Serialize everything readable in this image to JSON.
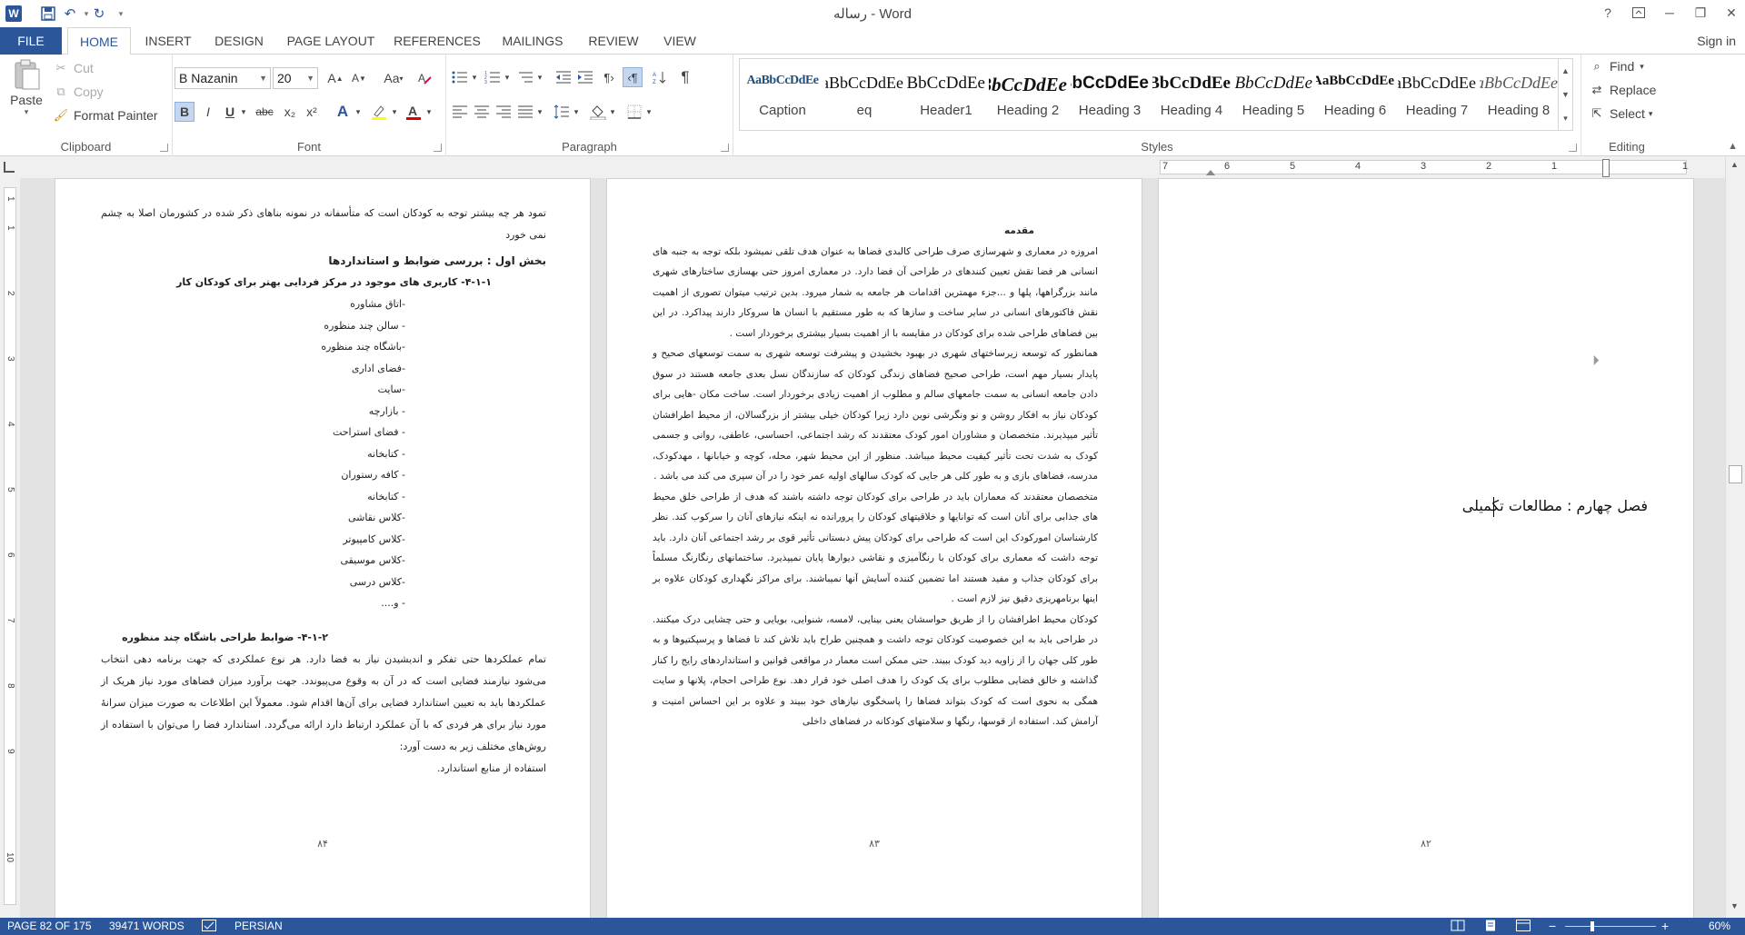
{
  "app": {
    "title": "رساله - Word",
    "qat": [
      "save-icon",
      "undo-icon",
      "redo-icon",
      "customize-icon"
    ],
    "window_buttons": [
      "?",
      "restore-ribbon",
      "─",
      "❐",
      "✕"
    ]
  },
  "tabs": {
    "file": "FILE",
    "items": [
      "HOME",
      "INSERT",
      "DESIGN",
      "PAGE LAYOUT",
      "REFERENCES",
      "MAILINGS",
      "REVIEW",
      "VIEW"
    ],
    "active": "HOME",
    "signin": "Sign in"
  },
  "clipboard": {
    "paste": "Paste",
    "cut": "Cut",
    "copy": "Copy",
    "format_painter": "Format Painter",
    "label": "Clipboard"
  },
  "font": {
    "name": "B Nazanin",
    "size": "20",
    "grow": "A",
    "shrink": "A",
    "case": "Aa",
    "bold": "B",
    "italic": "I",
    "underline": "U",
    "strike": "abc",
    "subscript": "x₂",
    "superscript": "x²",
    "label": "Font"
  },
  "paragraph": {
    "label": "Paragraph"
  },
  "styles": {
    "label": "Styles",
    "items": [
      {
        "sample": "AaBbCcDdEe",
        "name": "Caption"
      },
      {
        "sample": "AaBbCcDdEe",
        "name": "eq"
      },
      {
        "sample": "AaBbCcDdEe",
        "name": "Header1"
      },
      {
        "sample": "AaBbCcDdEe",
        "name": "Heading 2"
      },
      {
        "sample": "AaBbCcDdEe",
        "name": "Heading 3"
      },
      {
        "sample": "AaBbCcDdEe",
        "name": "Heading 4"
      },
      {
        "sample": "AaBbCcDdEe",
        "name": "Heading 5"
      },
      {
        "sample": "AaBbCcDdEe",
        "name": "Heading 6"
      },
      {
        "sample": "AaBbCcDdEe",
        "name": "Heading 7"
      },
      {
        "sample": "AaBbCcDdEe",
        "name": "Heading 8"
      }
    ]
  },
  "editing": {
    "find": "Find",
    "replace": "Replace",
    "select": "Select",
    "label": "Editing"
  },
  "ruler": [
    "7",
    "6",
    "5",
    "4",
    "3",
    "2",
    "1",
    "1"
  ],
  "v_ruler": [
    "1",
    "1",
    "2",
    "3",
    "4",
    "5",
    "6",
    "7",
    "8",
    "9",
    "10"
  ],
  "pages": {
    "left": {
      "paragraphs": [
        "تمود هر چه بیشتر توجه به کودکان است که متأسفانه در نمونه بناهای ذکر شده در کشورمان اصلا به چشم نمی خورد",
        "بخش اول : بررسی ضوابط و استانداردها",
        "۴-۱-۱- کاربری های موجود در مرکز فردایی بهتر برای کودکان کار",
        "-اتاق مشاوره",
        "- سالن چند منظوره",
        "-باشگاه چند منظوره",
        "-فضای اداری",
        "-سایت",
        "- بازارچه",
        "- فضای استراحت",
        "- کتابخانه",
        "- کافه رستوران",
        "- کتابخانه",
        "-کلاس نقاشی",
        "-کلاس کامپیوتر",
        "-کلاس موسیقی",
        "-کلاس درسی",
        "- و....",
        "۴-۱-۲- ضوابط طراحی باشگاه چند منظوره",
        "تمام عملکردها حتی تفکر و اندیشیدن نیاز به فضا دارد. هر نوع عملکردی که جهت برنامه دهی انتخاب می‌شود نیازمند فضایی است که در آن به وقوع می‌پیوندد. جهت برآورد میزان فضاهای مورد نیاز هریک از عملکردها باید به تعیین استاندارد فضایی برای آن‌ها اقدام شود. معمولاً این اطلاعات به صورت میزان سرانهٔ مورد نیاز برای هر فردی که با آن عملکرد ارتباط دارد ارائه می‌گردد. استاندارد فضا را می‌توان با استفاده از روش‌های مختلف زیر به دست آورد:",
        "استفاده از منابع استاندارد."
      ],
      "page_number": "۸۴"
    },
    "middle": {
      "heading": "مقدمه",
      "paragraphs": [
        "امروزه در معماری و شهرسازی صرف طراحی کالبدی فضاها به عنوان هدف تلقی نمیشود بلکه توجه به جنبه های انسانی هر فضا نقش تعیین کنندهای در طراحی آن فضا دارد. در معماری امروز حتی بهسازی ساختارهای شهری مانند بزرگراهها، پلها و ...جزء مهمترین اقدامات هر جامعه به شمار میرود. بدین ترتیب میتوان تصوری از اهمیت نقش فاکتورهای انسانی در سایر ساخت و سازها که به طور مستقیم با انسان ها سروکار دارند پیداکرد. در این بین فضاهای طراحی شده برای کودکان در مقایسه با از اهمیت بسیار بیشتری برخوردار است .",
        "همانطور که توسعه زیرساختهای شهری در بهبود بخشیدن و پیشرفت توسعه شهری به سمت توسعهای صحیح و پایدار بسیار مهم است، طراحی صحیح فضاهای زندگی کودکان که سازندگان نسل بعدی جامعه هستند در سوق دادن جامعه انسانی به سمت جامعهای سالم و مطلوب از اهمیت زیادی برخوردار است. ساخت مکان -هایی برای کودکان نیاز به افکار روشن و نو ونگرشی نوین دارد زیرا کودکان خیلی بیشتر از بزرگسالان، از محیط اطرافشان تأثیر میپذیرند. متخصصان و مشاوران امور کودک معتقدند که رشد اجتماعی، احساسی، عاطفی، روانی و جسمی کودک به شدت تحت تأثیر کیفیت محیط میباشد. منظور از این محیط شهر، محله، کوچه و خیابانها ، مهدکودک، مدرسه، فضاهای بازی و به طور کلی هر جایی که کودک سالهای اولیه عمر خود را در آن سپری می کند می باشد .",
        "متخصصان معتقدند که معماران باید در طراحی برای کودکان توجه داشته باشند که هدف از طراحی خلق محیط های جذابی برای آنان است که توانایها و خلاقیتهای کودکان را پرورانده نه اینکه نیازهای آنان را سرکوب کند. نظر کارشناسان امورکودک این است که طراحی برای کودکان پیش دبستانی تأثیر قوی بر رشد اجتماعی آنان دارد. باید توجه داشت که معماری برای کودکان با رنگآمیزی و نقاشی دیوارها پایان نمیپذیرد. ساختمانهای رنگارنگ مسلماً برای کودکان جذاب و مفید هستند اما تضمین کننده آسایش آنها نمیباشند. برای مراکز نگهداری کودکان علاوه بر اینها برنامهریزی دقیق نیز لازم است .",
        "کودکان محیط اطرافشان را از طریق حواسشان یعنی بینایی، لامسه، شنوایی، بویایی و حتی چشایی درک میکنند. در طراحی باید به این خصوصیت کودکان توجه داشت و همچنین طراح باید تلاش کند تا فضاها و پرسپکتیوها و به طور کلی جهان را از زاویه دید کودک ببیند. حتی ممکن است معمار در مواقعی قوانین و استانداردهای رایج را کنار گذاشته و خالق فضایی مطلوب برای یک کودک را هدف اصلی خود قرار دهد. نوع طراحی احجام، پلانها و سایت همگی به نحوی است که کودک بتواند فضاها را پاسخگوی نیازهای خود ببیند و علاوه بر این احساس امنیت و آرامش کند. استفاده از قوسها، رنگها و سلامتهای کودکانه در فضاهای داخلی"
      ],
      "page_number": "۸۳"
    },
    "right": {
      "heading": "فصل چهارم : مطالعات تکمیلی",
      "page_number": "۸۲"
    }
  },
  "status": {
    "page": "PAGE 82 OF 175",
    "words": "39471 WORDS",
    "language": "PERSIAN",
    "zoom": "60%",
    "zoom_level": 0.6
  }
}
